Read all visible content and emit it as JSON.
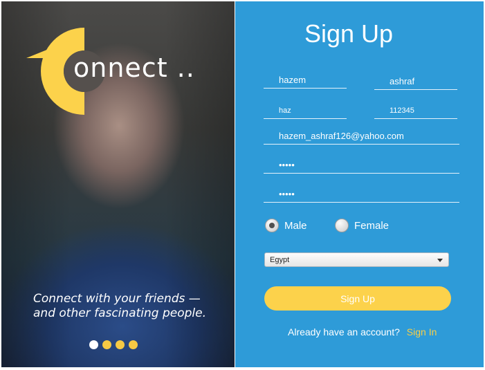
{
  "colors": {
    "accent_yellow": "#fcd24b",
    "panel_blue": "#2e9bd8",
    "text_white": "#ffffff"
  },
  "hero": {
    "logo_text": "onnect ..",
    "tagline_line1": "Connect with your friends —",
    "tagline_line2": "and other fascinating people.",
    "carousel": {
      "count": 4,
      "active_index": 0
    }
  },
  "form": {
    "title": "Sign Up",
    "first_name": "hazem",
    "last_name": "ashraf",
    "username": "haz",
    "phone": "112345",
    "email": "hazem_ashraf126@yahoo.com",
    "password": "•••••",
    "confirm_password": "•••••",
    "gender": {
      "male_label": "Male",
      "female_label": "Female",
      "selected": "Male"
    },
    "country": {
      "selected": "Egypt"
    },
    "submit_label": "Sign Up",
    "already_account_text": "Already have an account?",
    "signin_link": "Sign In"
  }
}
